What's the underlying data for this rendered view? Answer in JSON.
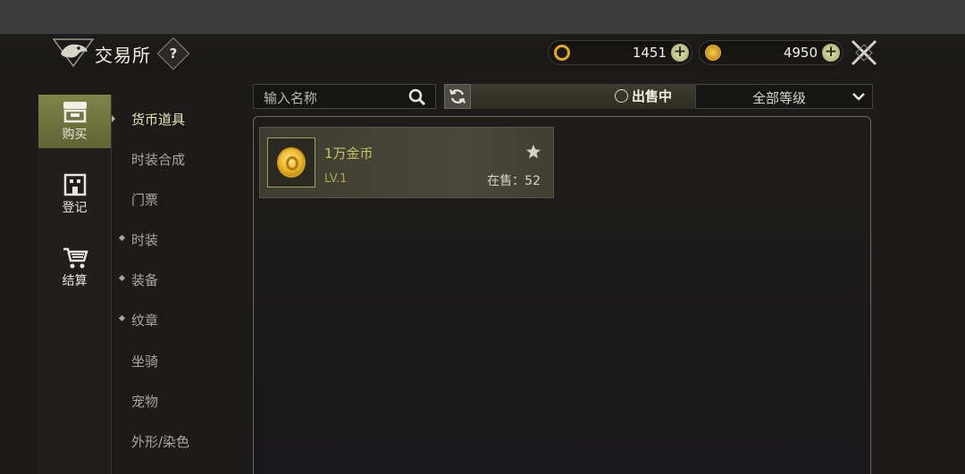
{
  "header": {
    "title": "交易所",
    "help_label": "?"
  },
  "currencies": [
    {
      "icon": "silver-coin-icon",
      "value": "1451",
      "plus": "+"
    },
    {
      "icon": "gold-coin-icon",
      "value": "4950",
      "plus": "+"
    }
  ],
  "nav": {
    "items": [
      {
        "label": "购买",
        "icon": "shop-icon",
        "active": true
      },
      {
        "label": "登记",
        "icon": "building-icon",
        "active": false
      },
      {
        "label": "结算",
        "icon": "cart-icon",
        "active": false
      }
    ]
  },
  "categories": [
    {
      "label": "货币道具",
      "active": true,
      "expandable": false
    },
    {
      "label": "时装合成",
      "active": false,
      "expandable": false
    },
    {
      "label": "门票",
      "active": false,
      "expandable": false
    },
    {
      "label": "时装",
      "active": false,
      "expandable": true
    },
    {
      "label": "装备",
      "active": false,
      "expandable": true
    },
    {
      "label": "纹章",
      "active": false,
      "expandable": true
    },
    {
      "label": "坐骑",
      "active": false,
      "expandable": false
    },
    {
      "label": "宠物",
      "active": false,
      "expandable": false
    },
    {
      "label": "外形/染色",
      "active": false,
      "expandable": false
    }
  ],
  "toolbar": {
    "search_placeholder": "输入名称",
    "on_sale_label": "出售中",
    "grade_select": "全部等级"
  },
  "items": [
    {
      "name": "1万金币",
      "level": "LV.1",
      "on_sale": "在售：52"
    }
  ],
  "colors": {
    "accent": "#7e8448",
    "item_name": "#c7c45f"
  }
}
